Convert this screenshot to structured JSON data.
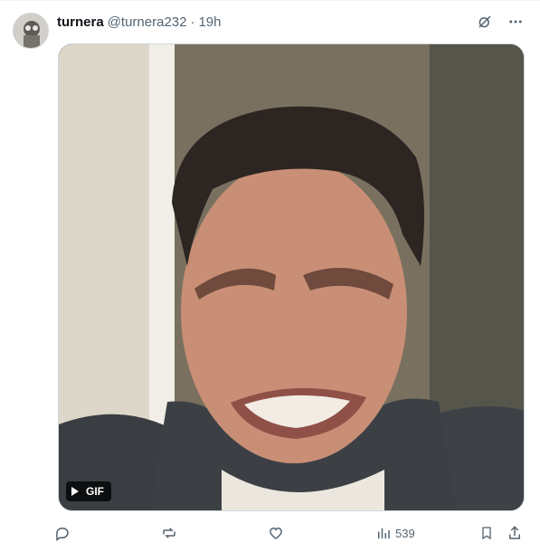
{
  "tweet": {
    "author_name": "turnera",
    "author_handle": "@turnera232",
    "separator": "·",
    "timestamp": "19h",
    "media": {
      "type_label": "GIF",
      "play_icon": "play-icon"
    },
    "actions": {
      "views_count": "539"
    }
  },
  "colors": {
    "text_primary": "#0f1419",
    "text_secondary": "#536471",
    "border": "#cfd9de",
    "gif_badge_bg": "#000000"
  }
}
